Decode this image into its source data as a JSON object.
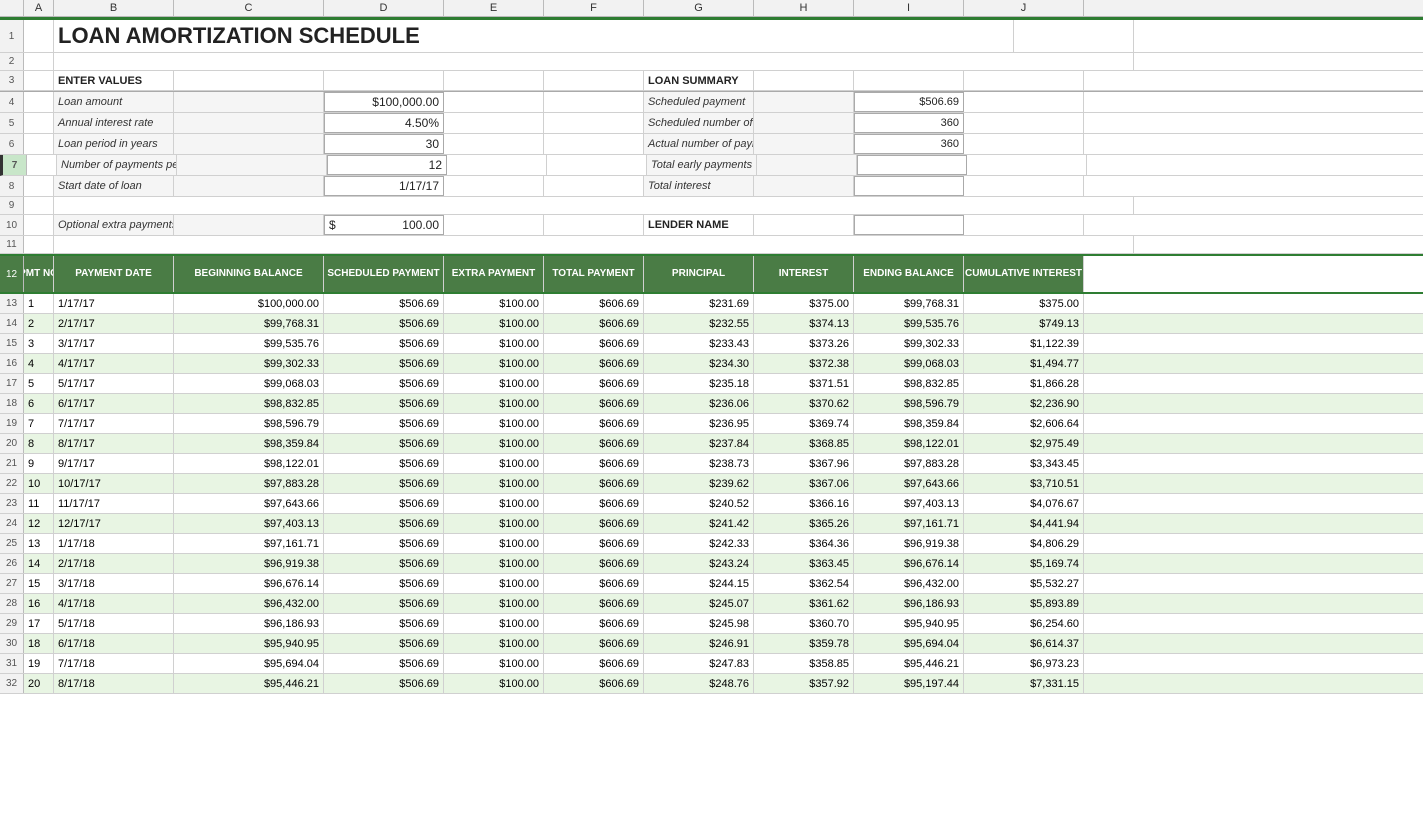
{
  "title": "LOAN AMORTIZATION SCHEDULE",
  "columns": [
    "",
    "A",
    "B",
    "C",
    "D",
    "E",
    "F",
    "G",
    "H",
    "I",
    "J"
  ],
  "inputSection": {
    "header": "ENTER VALUES",
    "fields": [
      {
        "label": "Loan amount",
        "value": "$100,000.00",
        "row": 4
      },
      {
        "label": "Annual interest rate",
        "value": "4.50%",
        "row": 5
      },
      {
        "label": "Loan period in years",
        "value": "30",
        "row": 6
      },
      {
        "label": "Number of payments per year",
        "value": "12",
        "row": 7
      },
      {
        "label": "Start date of loan",
        "value": "1/17/17",
        "row": 8
      },
      {
        "label": "Optional extra payments",
        "value": "100.00",
        "prefix": "$",
        "row": 10
      }
    ]
  },
  "summarySection": {
    "header": "LOAN SUMMARY",
    "fields": [
      {
        "label": "Scheduled payment",
        "value": "$506.69"
      },
      {
        "label": "Scheduled number of payments",
        "value": "360"
      },
      {
        "label": "Actual number of payments",
        "value": "360"
      },
      {
        "label": "Total early payments",
        "value": ""
      },
      {
        "label": "Total interest",
        "value": ""
      }
    ],
    "lenderLabel": "LENDER NAME",
    "lenderValue": ""
  },
  "tableHeaders": {
    "pmtNo": "PMT NO",
    "paymentDate": "PAYMENT DATE",
    "beginBalance": "BEGINNING BALANCE",
    "scheduledPayment": "SCHEDULED PAYMENT",
    "extraPayment": "EXTRA PAYMENT",
    "totalPayment": "TOTAL PAYMENT",
    "principal": "PRINCIPAL",
    "interest": "INTEREST",
    "endBalance": "ENDING BALANCE",
    "cumulativeInterest": "CUMULATIVE INTEREST"
  },
  "rows": [
    {
      "pmt": "1",
      "date": "1/17/17",
      "beginBal": "$100,000.00",
      "schedPmt": "$506.69",
      "extraPmt": "$100.00",
      "totalPmt": "$606.69",
      "principal": "$231.69",
      "interest": "$375.00",
      "endBal": "$99,768.31",
      "cumInterest": "$375.00"
    },
    {
      "pmt": "2",
      "date": "2/17/17",
      "beginBal": "$99,768.31",
      "schedPmt": "$506.69",
      "extraPmt": "$100.00",
      "totalPmt": "$606.69",
      "principal": "$232.55",
      "interest": "$374.13",
      "endBal": "$99,535.76",
      "cumInterest": "$749.13"
    },
    {
      "pmt": "3",
      "date": "3/17/17",
      "beginBal": "$99,535.76",
      "schedPmt": "$506.69",
      "extraPmt": "$100.00",
      "totalPmt": "$606.69",
      "principal": "$233.43",
      "interest": "$373.26",
      "endBal": "$99,302.33",
      "cumInterest": "$1,122.39"
    },
    {
      "pmt": "4",
      "date": "4/17/17",
      "beginBal": "$99,302.33",
      "schedPmt": "$506.69",
      "extraPmt": "$100.00",
      "totalPmt": "$606.69",
      "principal": "$234.30",
      "interest": "$372.38",
      "endBal": "$99,068.03",
      "cumInterest": "$1,494.77"
    },
    {
      "pmt": "5",
      "date": "5/17/17",
      "beginBal": "$99,068.03",
      "schedPmt": "$506.69",
      "extraPmt": "$100.00",
      "totalPmt": "$606.69",
      "principal": "$235.18",
      "interest": "$371.51",
      "endBal": "$98,832.85",
      "cumInterest": "$1,866.28"
    },
    {
      "pmt": "6",
      "date": "6/17/17",
      "beginBal": "$98,832.85",
      "schedPmt": "$506.69",
      "extraPmt": "$100.00",
      "totalPmt": "$606.69",
      "principal": "$236.06",
      "interest": "$370.62",
      "endBal": "$98,596.79",
      "cumInterest": "$2,236.90"
    },
    {
      "pmt": "7",
      "date": "7/17/17",
      "beginBal": "$98,596.79",
      "schedPmt": "$506.69",
      "extraPmt": "$100.00",
      "totalPmt": "$606.69",
      "principal": "$236.95",
      "interest": "$369.74",
      "endBal": "$98,359.84",
      "cumInterest": "$2,606.64"
    },
    {
      "pmt": "8",
      "date": "8/17/17",
      "beginBal": "$98,359.84",
      "schedPmt": "$506.69",
      "extraPmt": "$100.00",
      "totalPmt": "$606.69",
      "principal": "$237.84",
      "interest": "$368.85",
      "endBal": "$98,122.01",
      "cumInterest": "$2,975.49"
    },
    {
      "pmt": "9",
      "date": "9/17/17",
      "beginBal": "$98,122.01",
      "schedPmt": "$506.69",
      "extraPmt": "$100.00",
      "totalPmt": "$606.69",
      "principal": "$238.73",
      "interest": "$367.96",
      "endBal": "$97,883.28",
      "cumInterest": "$3,343.45"
    },
    {
      "pmt": "10",
      "date": "10/17/17",
      "beginBal": "$97,883.28",
      "schedPmt": "$506.69",
      "extraPmt": "$100.00",
      "totalPmt": "$606.69",
      "principal": "$239.62",
      "interest": "$367.06",
      "endBal": "$97,643.66",
      "cumInterest": "$3,710.51"
    },
    {
      "pmt": "11",
      "date": "11/17/17",
      "beginBal": "$97,643.66",
      "schedPmt": "$506.69",
      "extraPmt": "$100.00",
      "totalPmt": "$606.69",
      "principal": "$240.52",
      "interest": "$366.16",
      "endBal": "$97,403.13",
      "cumInterest": "$4,076.67"
    },
    {
      "pmt": "12",
      "date": "12/17/17",
      "beginBal": "$97,403.13",
      "schedPmt": "$506.69",
      "extraPmt": "$100.00",
      "totalPmt": "$606.69",
      "principal": "$241.42",
      "interest": "$365.26",
      "endBal": "$97,161.71",
      "cumInterest": "$4,441.94"
    },
    {
      "pmt": "13",
      "date": "1/17/18",
      "beginBal": "$97,161.71",
      "schedPmt": "$506.69",
      "extraPmt": "$100.00",
      "totalPmt": "$606.69",
      "principal": "$242.33",
      "interest": "$364.36",
      "endBal": "$96,919.38",
      "cumInterest": "$4,806.29"
    },
    {
      "pmt": "14",
      "date": "2/17/18",
      "beginBal": "$96,919.38",
      "schedPmt": "$506.69",
      "extraPmt": "$100.00",
      "totalPmt": "$606.69",
      "principal": "$243.24",
      "interest": "$363.45",
      "endBal": "$96,676.14",
      "cumInterest": "$5,169.74"
    },
    {
      "pmt": "15",
      "date": "3/17/18",
      "beginBal": "$96,676.14",
      "schedPmt": "$506.69",
      "extraPmt": "$100.00",
      "totalPmt": "$606.69",
      "principal": "$244.15",
      "interest": "$362.54",
      "endBal": "$96,432.00",
      "cumInterest": "$5,532.27"
    },
    {
      "pmt": "16",
      "date": "4/17/18",
      "beginBal": "$96,432.00",
      "schedPmt": "$506.69",
      "extraPmt": "$100.00",
      "totalPmt": "$606.69",
      "principal": "$245.07",
      "interest": "$361.62",
      "endBal": "$96,186.93",
      "cumInterest": "$5,893.89"
    },
    {
      "pmt": "17",
      "date": "5/17/18",
      "beginBal": "$96,186.93",
      "schedPmt": "$506.69",
      "extraPmt": "$100.00",
      "totalPmt": "$606.69",
      "principal": "$245.98",
      "interest": "$360.70",
      "endBal": "$95,940.95",
      "cumInterest": "$6,254.60"
    },
    {
      "pmt": "18",
      "date": "6/17/18",
      "beginBal": "$95,940.95",
      "schedPmt": "$506.69",
      "extraPmt": "$100.00",
      "totalPmt": "$606.69",
      "principal": "$246.91",
      "interest": "$359.78",
      "endBal": "$95,694.04",
      "cumInterest": "$6,614.37"
    },
    {
      "pmt": "19",
      "date": "7/17/18",
      "beginBal": "$95,694.04",
      "schedPmt": "$506.69",
      "extraPmt": "$100.00",
      "totalPmt": "$606.69",
      "principal": "$247.83",
      "interest": "$358.85",
      "endBal": "$95,446.21",
      "cumInterest": "$6,973.23"
    },
    {
      "pmt": "20",
      "date": "8/17/18",
      "beginBal": "$95,446.21",
      "schedPmt": "$506.69",
      "extraPmt": "$100.00",
      "totalPmt": "$606.69",
      "principal": "$248.76",
      "interest": "$357.92",
      "endBal": "$95,197.44",
      "cumInterest": "$7,331.15"
    }
  ]
}
